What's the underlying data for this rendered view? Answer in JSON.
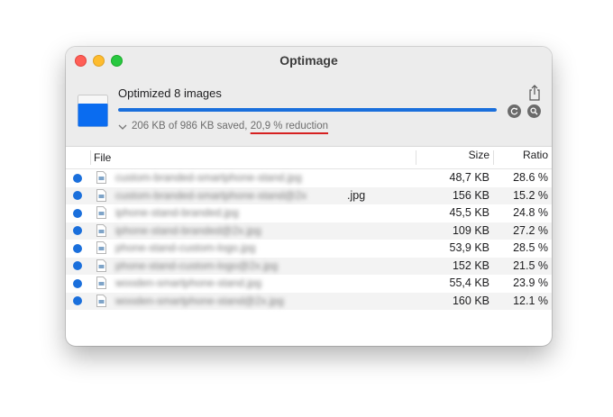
{
  "window": {
    "title": "Optimage"
  },
  "header": {
    "headline": "Optimized 8 images",
    "progress": 1.0,
    "summary_prefix": "206 KB of 986 KB saved, ",
    "summary_highlight": "20,9 % reduction"
  },
  "table": {
    "columns": {
      "file": "File",
      "size": "Size",
      "ratio": "Ratio"
    },
    "rows": [
      {
        "name": "custom-branded-smartphone-stand.jpg",
        "ext": "",
        "size": "48,7 KB",
        "ratio": "28.6 %"
      },
      {
        "name": "custom-branded-smartphone-stand@2x",
        "ext": ".jpg",
        "size": "156 KB",
        "ratio": "15.2 %"
      },
      {
        "name": "iphone-stand-branded.jpg",
        "ext": "",
        "size": "45,5 KB",
        "ratio": "24.8 %"
      },
      {
        "name": "iphone-stand-branded@2x.jpg",
        "ext": "",
        "size": "109 KB",
        "ratio": "27.2 %"
      },
      {
        "name": "phone-stand-custom-logo.jpg",
        "ext": "",
        "size": "53,9 KB",
        "ratio": "28.5 %"
      },
      {
        "name": "phone-stand-custom-logo@2x.jpg",
        "ext": "",
        "size": "152 KB",
        "ratio": "21.5 %"
      },
      {
        "name": "wooden-smartphone-stand.jpg",
        "ext": "",
        "size": "55,4 KB",
        "ratio": "23.9 %"
      },
      {
        "name": "wooden-smartphone-stand@2x.jpg",
        "ext": "",
        "size": "160 KB",
        "ratio": "12.1 %"
      }
    ]
  },
  "colors": {
    "accent": "#1a6fdc",
    "highlight_underline": "#d62020"
  },
  "icons": [
    "close-icon",
    "minimize-icon",
    "zoom-icon",
    "share-icon",
    "document-icon",
    "refresh-icon",
    "search-icon",
    "chevron-down-icon",
    "image-file-icon"
  ]
}
